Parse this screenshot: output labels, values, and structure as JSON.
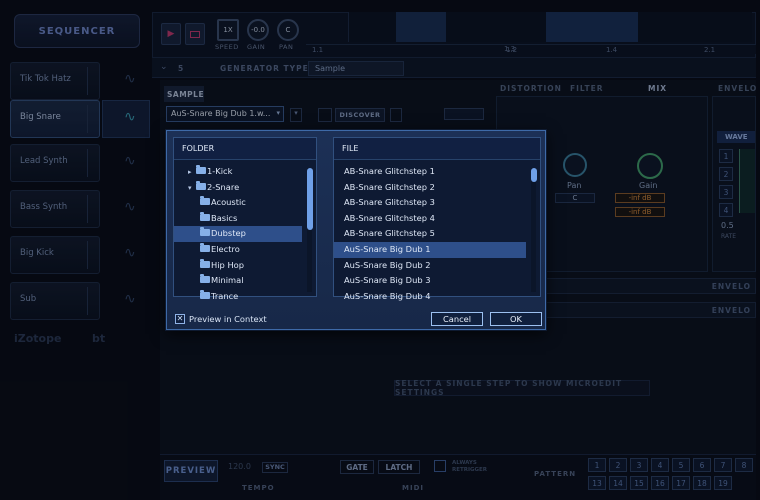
{
  "app": {
    "section_title": "SEQUENCER",
    "tracks": [
      {
        "label": "Tik Tok Hatz",
        "selected": false
      },
      {
        "label": "Big Snare",
        "selected": true
      },
      {
        "label": "Lead Synth",
        "selected": false
      },
      {
        "label": "Bass Synth",
        "selected": false
      },
      {
        "label": "Big Kick",
        "selected": false
      },
      {
        "label": "Sub",
        "selected": false
      }
    ],
    "transport": {
      "speed_value": "1X",
      "speed_label": "SPEED",
      "gain_value": "-0.0",
      "gain_label": "GAIN",
      "pan_value": "C",
      "pan_label": "PAN"
    },
    "ruler": [
      "1.1",
      "1.2",
      "1.3",
      "1.4",
      "2.1"
    ],
    "generator": {
      "index": "5",
      "label": "GENERATOR TYPE",
      "value": "Sample"
    },
    "sample_tab": "SAMPLE",
    "sample_selector": "AuS-Snare Big Dub 1.w...",
    "discover_label": "DISCOVER",
    "tabs": {
      "distortion": "DISTORTION",
      "filter": "FILTER",
      "mix": "MIX",
      "envelope": "ENVELO"
    },
    "mix": {
      "pan_label": "Pan",
      "pan_value": "C",
      "gain_label": "Gain",
      "gain_value": "-inf dB",
      "gain_value2": "-inf dB"
    },
    "wave_label": "WAVE",
    "wave_numbers": [
      "1",
      "2",
      "3",
      "4"
    ],
    "rate_value": "0.5",
    "rate_label": "RATE",
    "envelope_bars": [
      "ENVELO",
      "ENVELO"
    ],
    "microedit_hint": "SELECT A SINGLE STEP TO SHOW MICROEDIT SETTINGS",
    "bottom": {
      "preview_label": "PREVIEW",
      "tempo_value": "120.0",
      "sync_label": "SYNC",
      "tempo_label": "TEMPO",
      "gate_label": "GATE",
      "latch_label": "LATCH",
      "always_retrigger": "ALWAYS RETRIGGER",
      "midi_label": "MIDI",
      "pattern_label": "PATTERN",
      "pattern_row1": [
        "1",
        "2",
        "3",
        "4",
        "5",
        "6",
        "7",
        "8"
      ],
      "pattern_row2": [
        "13",
        "14",
        "15",
        "16",
        "17",
        "18",
        "19"
      ]
    },
    "logos": {
      "izotope": "iZotope",
      "bt": "bt"
    }
  },
  "dialog": {
    "folder_header": "FOLDER",
    "file_header": "FILE",
    "folders": [
      {
        "label": "1-Kick",
        "indent": 0,
        "arrow": "▸",
        "selected": false
      },
      {
        "label": "2-Snare",
        "indent": 0,
        "arrow": "▾",
        "selected": false
      },
      {
        "label": "Acoustic",
        "indent": 1,
        "arrow": "",
        "selected": false
      },
      {
        "label": "Basics",
        "indent": 1,
        "arrow": "",
        "selected": false
      },
      {
        "label": "Dubstep",
        "indent": 1,
        "arrow": "",
        "selected": true
      },
      {
        "label": "Electro",
        "indent": 1,
        "arrow": "",
        "selected": false
      },
      {
        "label": "Hip Hop",
        "indent": 1,
        "arrow": "",
        "selected": false
      },
      {
        "label": "Minimal",
        "indent": 1,
        "arrow": "",
        "selected": false
      },
      {
        "label": "Trance",
        "indent": 1,
        "arrow": "",
        "selected": false
      }
    ],
    "files": [
      {
        "label": "AB-Snare Glitchstep 1",
        "selected": false
      },
      {
        "label": "AB-Snare Glitchstep 2",
        "selected": false
      },
      {
        "label": "AB-Snare Glitchstep 3",
        "selected": false
      },
      {
        "label": "AB-Snare Glitchstep 4",
        "selected": false
      },
      {
        "label": "AB-Snare Glitchstep 5",
        "selected": false
      },
      {
        "label": "AuS-Snare Big Dub 1",
        "selected": true
      },
      {
        "label": "AuS-Snare Big Dub 2",
        "selected": false
      },
      {
        "label": "AuS-Snare Big Dub 3",
        "selected": false
      },
      {
        "label": "AuS-Snare Big Dub 4",
        "selected": false
      }
    ],
    "preview_in_context": "Preview in Context",
    "preview_checked": true,
    "cancel_label": "Cancel",
    "ok_label": "OK"
  }
}
